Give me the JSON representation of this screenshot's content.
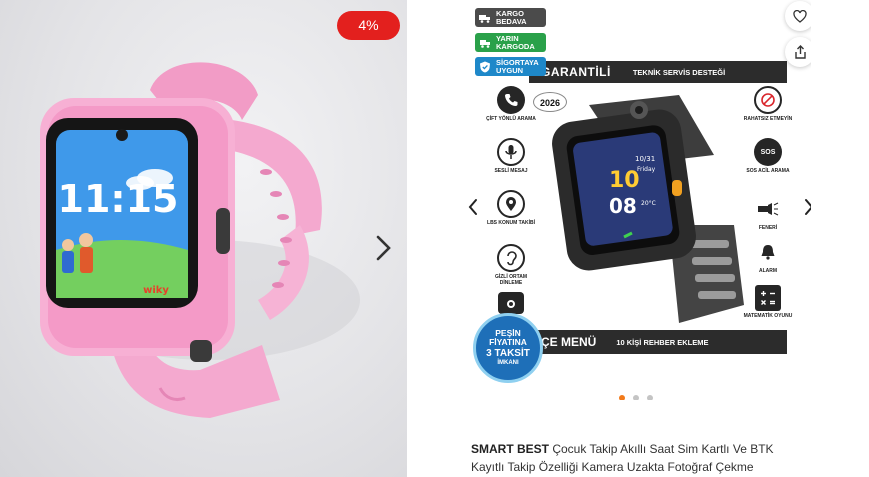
{
  "left_card": {
    "discount_badge": "4%",
    "watch_time": "11:15",
    "screen_brand": "wiky"
  },
  "right_card": {
    "chips": [
      {
        "label": "KARGO BEDAVA",
        "color": "#4b4b4b",
        "icon": "truck-icon"
      },
      {
        "label": "YARIN KARGODA",
        "color": "#2aa14a",
        "icon": "fast-truck-icon"
      },
      {
        "label": "SİGORTAYA UYGUN",
        "color": "#1e88c9",
        "icon": "shield-icon"
      }
    ],
    "banner_top": {
      "garantili": "GARANTİLİ",
      "teknik": "TEKNİK SERVİS DESTEĞİ"
    },
    "banner_bottom": {
      "menu": "ÇE MENÜ",
      "rehber": "10 KİŞİ REHBER EKLEME"
    },
    "year_badge": "2026",
    "watch_screen": {
      "hour": "10",
      "minute": "08",
      "date": "10/31",
      "day": "Friday",
      "temp": "20°C"
    },
    "features_left": [
      {
        "label": "ÇİFT YÖNLÜ ARAMA",
        "icon": "phone-icon"
      },
      {
        "label": "SESLİ MESAJ",
        "icon": "microphone-icon"
      },
      {
        "label": "LBS KONUM TAKİBİ",
        "icon": "location-pin-icon"
      },
      {
        "label": "GİZLİ ORTAM DİNLEME",
        "icon": "ear-icon"
      },
      {
        "label": "",
        "icon": "camera-icon"
      }
    ],
    "features_right": [
      {
        "label": "RAHATSIZ ETMEYİN",
        "icon": "no-call-icon"
      },
      {
        "label": "SOS ACİL ARAMA",
        "icon": "sos-icon"
      },
      {
        "label": "FENERİ",
        "icon": "flashlight-icon"
      },
      {
        "label": "ALARM",
        "icon": "alarm-bell-icon"
      },
      {
        "label": "MATEMATİK OYUNU",
        "icon": "calculator-icon"
      }
    ],
    "promo": {
      "line1": "PEŞİN FİYATINA",
      "line2": "3 TAKSİT",
      "line3": "İMKANI"
    },
    "carousel": {
      "total": 3,
      "active": 0
    },
    "title": {
      "brand": "SMART BEST",
      "text": " Çocuk Takip Akıllı Saat Sim Kartlı Ve BTK Kayıtlı Takip Özelliği Kamera Uzakta Fotoğraf Çekme"
    }
  },
  "colors": {
    "discount_red": "#e3201e",
    "dot_active": "#f27a1a",
    "dot_inactive": "#c4c4c4",
    "strap_pink": "#f4a9cf"
  }
}
